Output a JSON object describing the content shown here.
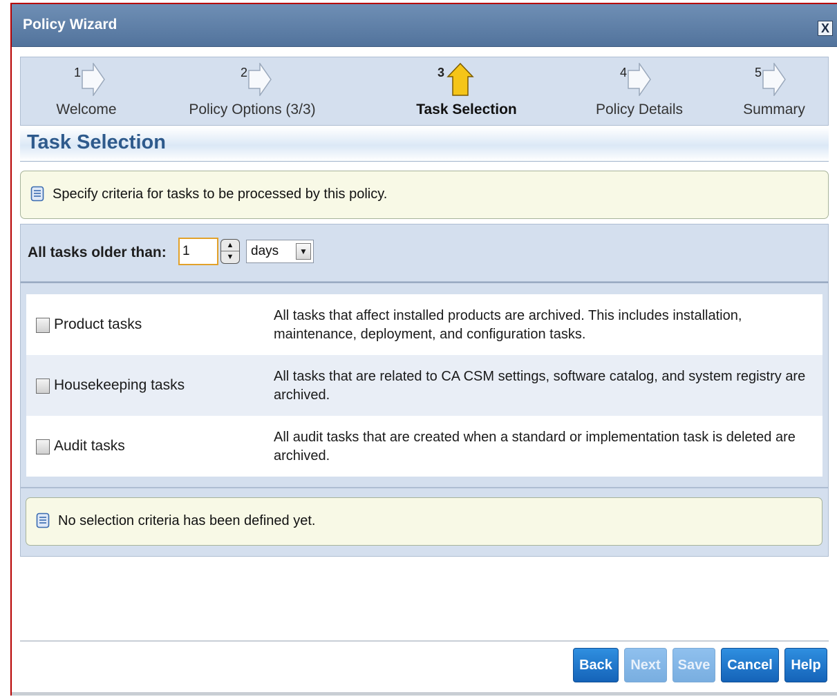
{
  "window": {
    "title": "Policy Wizard",
    "close_glyph": "X"
  },
  "steps": [
    {
      "num": "1",
      "label": "Welcome",
      "state": "pending"
    },
    {
      "num": "2",
      "label": "Policy Options (3/3)",
      "state": "pending"
    },
    {
      "num": "3",
      "label": "Task Selection",
      "state": "active"
    },
    {
      "num": "4",
      "label": "Policy Details",
      "state": "pending"
    },
    {
      "num": "5",
      "label": "Summary",
      "state": "pending"
    }
  ],
  "section": {
    "title": "Task Selection"
  },
  "hint": {
    "text": "Specify criteria for tasks to be processed by this policy."
  },
  "filter": {
    "label": "All tasks older than:",
    "value": "1",
    "unit": "days"
  },
  "tasks": [
    {
      "name": "Product tasks",
      "checked": false,
      "description": "All tasks that affect installed products are archived. This includes installation, maintenance, deployment, and configuration tasks."
    },
    {
      "name": "Housekeeping tasks",
      "checked": false,
      "description": "All tasks that are related to CA CSM settings, software catalog, and system registry are archived."
    },
    {
      "name": "Audit tasks",
      "checked": false,
      "description": "All audit tasks that are created when a standard or implementation task is deleted are archived."
    }
  ],
  "status": {
    "text": "No selection criteria has been defined yet."
  },
  "buttons": {
    "back": "Back",
    "next": "Next",
    "save": "Save",
    "cancel": "Cancel",
    "help": "Help"
  },
  "colors": {
    "titlebar": "#5f80aa",
    "active_step": "#f5c518",
    "button": "#1e78d0",
    "button_disabled": "#86b8e8"
  }
}
